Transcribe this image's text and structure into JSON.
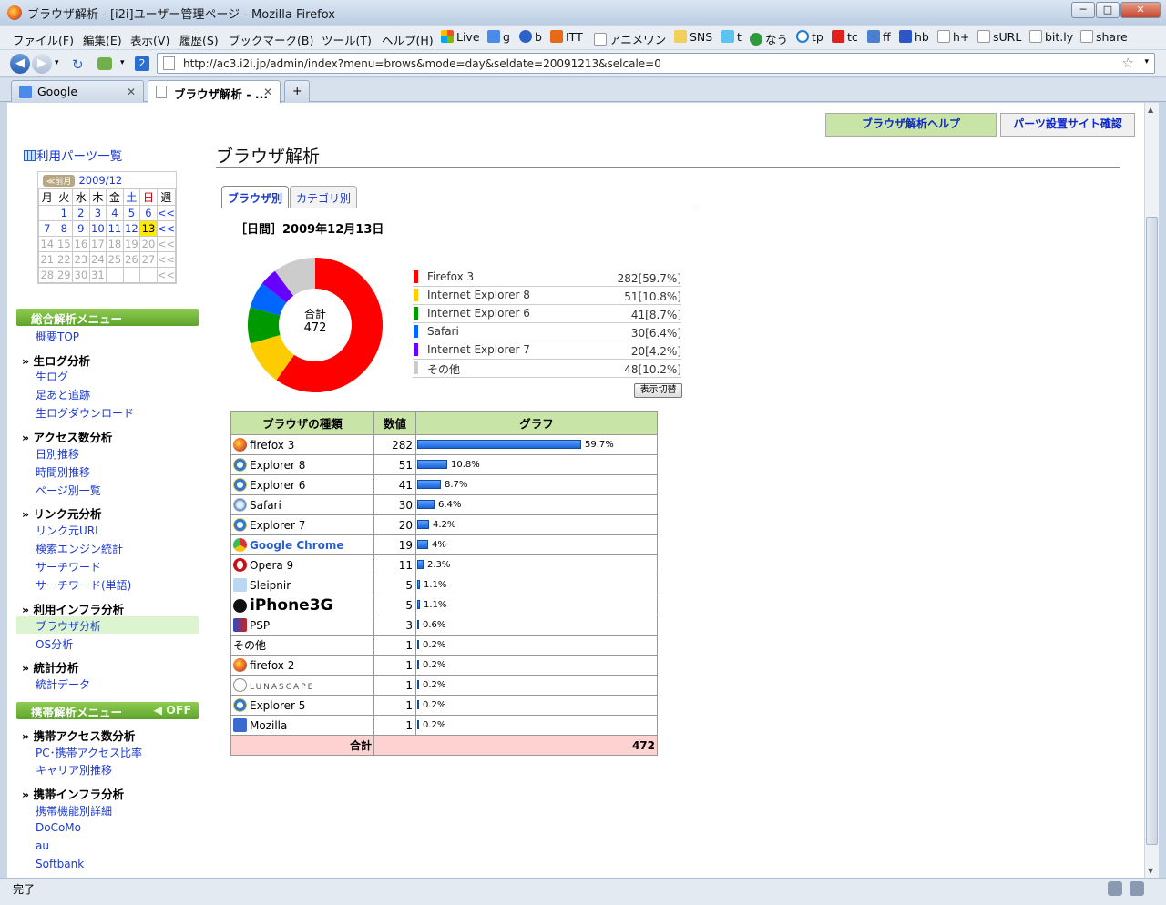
{
  "window": {
    "title": "ブラウザ解析 - [i2i]ユーザー管理ページ - Mozilla Firefox"
  },
  "menu": [
    "ファイル(F)",
    "編集(E)",
    "表示(V)",
    "履歴(S)",
    "ブックマーク(B)",
    "ツール(T)",
    "ヘルプ(H)"
  ],
  "bookmarks": [
    "Live",
    "g",
    "b",
    "ITT",
    "アニメワン",
    "SNS",
    "t",
    "なう",
    "tp",
    "tc",
    "ff",
    "hb",
    "h+",
    "sURL",
    "bit.ly",
    "share"
  ],
  "nav": {
    "url": "http://ac3.i2i.jp/admin/index?menu=brows&mode=day&seldate=20091213&selcale=0"
  },
  "tabs": [
    {
      "label": "Google"
    },
    {
      "label": "ブラウザ解析 - ..."
    }
  ],
  "status": "完了",
  "page": {
    "title": "ブラウザ解析",
    "top_buttons": [
      "ブラウザ解析ヘルプ",
      "パーツ設置サイト確認"
    ],
    "parts_link": "利用パーツ一覧",
    "calendar": {
      "prev": "≪前月",
      "month": "2009/12",
      "headers": [
        "月",
        "火",
        "水",
        "木",
        "金",
        "土",
        "日",
        "週"
      ],
      "rows": [
        [
          "",
          "1",
          "2",
          "3",
          "4",
          "5",
          "6",
          "<<"
        ],
        [
          "7",
          "8",
          "9",
          "10",
          "11",
          "12",
          "13",
          "<<"
        ],
        [
          "14",
          "15",
          "16",
          "17",
          "18",
          "19",
          "20",
          "<<"
        ],
        [
          "21",
          "22",
          "23",
          "24",
          "25",
          "26",
          "27",
          "<<"
        ],
        [
          "28",
          "29",
          "30",
          "31",
          "",
          "",
          "",
          "<<"
        ]
      ],
      "today": "13"
    },
    "menu_main": "総合解析メニュー",
    "menu_mobile": "携帯解析メニュー",
    "mobile_off": "OFF",
    "groups": {
      "top": "概要TOP",
      "rawlog": "生ログ分析",
      "rawlog_items": [
        "生ログ",
        "足あと追跡",
        "生ログダウンロード"
      ],
      "access": "アクセス数分析",
      "access_items": [
        "日別推移",
        "時間別推移",
        "ページ別一覧"
      ],
      "link": "リンク元分析",
      "link_items": [
        "リンク元URL",
        "検索エンジン統計",
        "サーチワード",
        "サーチワード(単語)"
      ],
      "infra": "利用インフラ分析",
      "infra_items": [
        "ブラウザ分析",
        "OS分析"
      ],
      "stats": "統計分析",
      "stats_items": [
        "統計データ"
      ],
      "m_access": "携帯アクセス数分析",
      "m_access_items": [
        "PC･携帯アクセス比率",
        "キャリア別推移"
      ],
      "m_infra": "携帯インフラ分析",
      "m_infra_items": [
        "携帯機能別詳細",
        "DoCoMo",
        "au",
        "Softbank"
      ]
    },
    "subtabs": [
      "ブラウザ別",
      "カテゴリ別"
    ],
    "date_label": "［日間］2009年12月13日",
    "donut_label": "合計",
    "donut_total": "472",
    "toggle": "表示切替",
    "table_headers": [
      "ブラウザの種類",
      "数値",
      "グラフ"
    ],
    "total_label": "合計",
    "total_value": "472"
  },
  "chart_data": {
    "type": "pie",
    "title": "",
    "total": 472,
    "slices": [
      {
        "name": "Firefox 3",
        "value": 282,
        "label": "282[59.7%]",
        "color": "#ff0000"
      },
      {
        "name": "Internet Explorer 8",
        "value": 51,
        "label": "51[10.8%]",
        "color": "#ffcc00"
      },
      {
        "name": "Internet Explorer 6",
        "value": 41,
        "label": "41[8.7%]",
        "color": "#009900"
      },
      {
        "name": "Safari",
        "value": 30,
        "label": "30[6.4%]",
        "color": "#0066ff"
      },
      {
        "name": "Internet Explorer 7",
        "value": 20,
        "label": "20[4.2%]",
        "color": "#6600ff"
      },
      {
        "name": "その他",
        "value": 48,
        "label": "48[10.2%]",
        "color": "#cccccc"
      }
    ],
    "browsers": [
      {
        "name": "firefox 3",
        "value": 282,
        "pct": "59.7%",
        "icon": "firefox"
      },
      {
        "name": "Explorer 8",
        "value": 51,
        "pct": "10.8%",
        "icon": "ie"
      },
      {
        "name": "Explorer 6",
        "value": 41,
        "pct": "8.7%",
        "icon": "ie"
      },
      {
        "name": "Safari",
        "value": 30,
        "pct": "6.4%",
        "icon": "safari"
      },
      {
        "name": "Explorer 7",
        "value": 20,
        "pct": "4.2%",
        "icon": "ie"
      },
      {
        "name": "Google Chrome",
        "value": 19,
        "pct": "4%",
        "icon": "chrome"
      },
      {
        "name": "Opera 9",
        "value": 11,
        "pct": "2.3%",
        "icon": "opera"
      },
      {
        "name": "Sleipnir",
        "value": 5,
        "pct": "1.1%",
        "icon": "sleipnir"
      },
      {
        "name": "iPhone3G",
        "value": 5,
        "pct": "1.1%",
        "icon": "apple"
      },
      {
        "name": "PSP",
        "value": 3,
        "pct": "0.6%",
        "icon": "psp"
      },
      {
        "name": "その他",
        "value": 1,
        "pct": "0.2%",
        "icon": "none"
      },
      {
        "name": "firefox 2",
        "value": 1,
        "pct": "0.2%",
        "icon": "firefox"
      },
      {
        "name": "LUNASCAPE",
        "value": 1,
        "pct": "0.2%",
        "icon": "lunascape"
      },
      {
        "name": "Explorer 5",
        "value": 1,
        "pct": "0.2%",
        "icon": "ie"
      },
      {
        "name": "Mozilla",
        "value": 1,
        "pct": "0.2%",
        "icon": "mozilla"
      }
    ]
  }
}
